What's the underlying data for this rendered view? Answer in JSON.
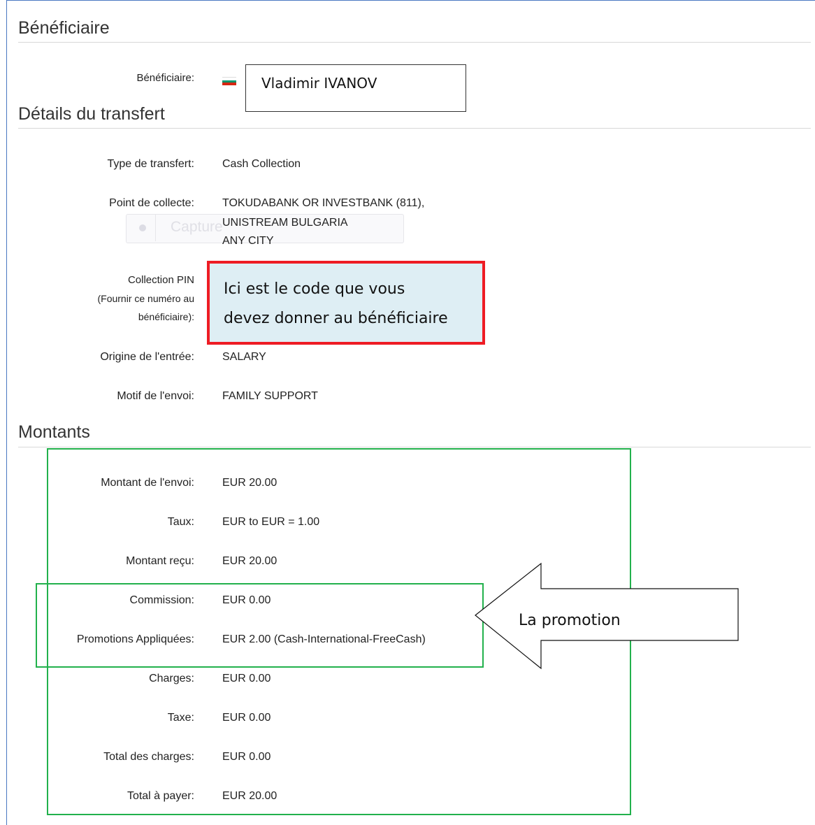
{
  "beneficiary_section": {
    "title": "Bénéficiaire",
    "label": "Bénéficiaire:",
    "flag_icon": "bulgaria-flag-icon",
    "flag_colors": [
      "#ffffff",
      "#00966e",
      "#d62612"
    ],
    "name": "Vladimir IVANOV"
  },
  "transfer_section": {
    "title": "Détails du transfert",
    "type_label": "Type de transfert:",
    "type_value": "Cash Collection",
    "collect_label": "Point de collecte:",
    "collect_lines": [
      "TOKUDABANK OR INVESTBANK (811),",
      "UNISTREAM BULGARIA",
      "ANY CITY"
    ],
    "ghost_capture_text": "Capture",
    "pin_label_lines": [
      "Collection PIN",
      "(Fournir ce numéro au",
      "bénéficiaire):"
    ],
    "pin_note_lines": [
      "Ici est le code que vous",
      "devez donner au bénéficiaire"
    ],
    "origin_label": "Origine de l'entrée:",
    "origin_value": "SALARY",
    "motive_label": "Motif de l'envoi:",
    "motive_value": "FAMILY SUPPORT"
  },
  "amounts_section": {
    "title": "Montants",
    "rows": [
      {
        "label": "Montant de l'envoi:",
        "value": "EUR 20.00"
      },
      {
        "label": "Taux:",
        "value": "EUR to EUR = 1.00"
      },
      {
        "label": "Montant reçu:",
        "value": "EUR 20.00"
      },
      {
        "label": "Commission:",
        "value": "EUR 0.00"
      },
      {
        "label": "Promotions Appliquées:",
        "value": "EUR 2.00 (Cash-International-FreeCash)"
      },
      {
        "label": "Charges:",
        "value": "EUR 0.00"
      },
      {
        "label": "Taxe:",
        "value": "EUR 0.00"
      },
      {
        "label": "Total des charges:",
        "value": "EUR 0.00"
      },
      {
        "label": "Total à payer:",
        "value": "EUR 20.00"
      }
    ]
  },
  "annotations": {
    "promotion_arrow_text": "La promotion",
    "highlight_color_red": "#ee1c24",
    "highlight_color_green": "#22b14c"
  }
}
